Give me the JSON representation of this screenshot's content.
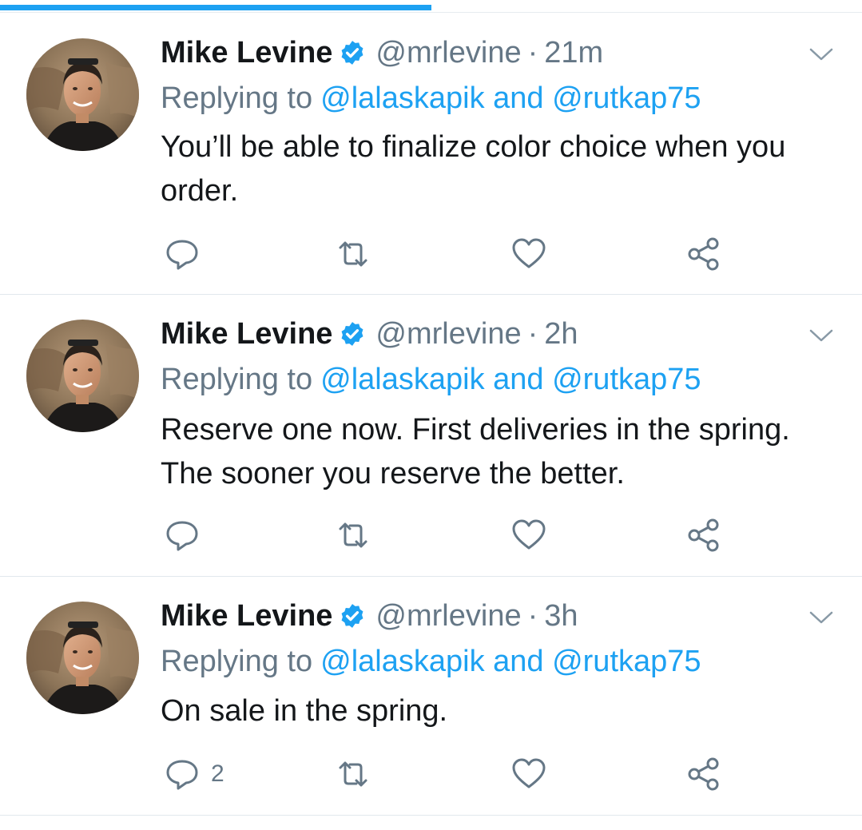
{
  "colors": {
    "accent": "#1da1f2",
    "text": "#14171a",
    "secondary": "#657786",
    "divider": "#e1e8ed"
  },
  "tweets": [
    {
      "author": "Mike Levine",
      "handle": "@mrlevine",
      "separator": "·",
      "time": "21m",
      "replying_prefix": "Replying to",
      "replying_users": "@lalaskapik and @rutkap75",
      "text": "You’ll be able to finalize color choice when you order.",
      "reply_count": ""
    },
    {
      "author": "Mike Levine",
      "handle": "@mrlevine",
      "separator": "·",
      "time": "2h",
      "replying_prefix": "Replying to",
      "replying_users": "@lalaskapik and @rutkap75",
      "text": "Reserve one now. First deliveries in the spring. The sooner you reserve the better.",
      "reply_count": ""
    },
    {
      "author": "Mike Levine",
      "handle": "@mrlevine",
      "separator": "·",
      "time": "3h",
      "replying_prefix": "Replying to",
      "replying_users": "@lalaskapik and @rutkap75",
      "text": "On sale in the spring.",
      "reply_count": "2"
    }
  ],
  "icons": {
    "verified": "verified-badge-icon",
    "caret": "chevron-down-icon",
    "reply": "reply-icon",
    "retweet": "retweet-icon",
    "like": "heart-icon",
    "share": "share-icon"
  },
  "progress": {
    "fraction": 0.5
  }
}
